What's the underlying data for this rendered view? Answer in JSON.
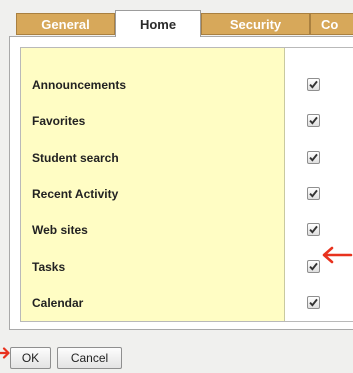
{
  "tabs": [
    {
      "label": "General",
      "active": false
    },
    {
      "label": "Home",
      "active": true
    },
    {
      "label": "Security",
      "active": false
    },
    {
      "label": "Co",
      "active": false
    }
  ],
  "settings": {
    "rows": [
      {
        "label": "Announcements",
        "checked": true
      },
      {
        "label": "Favorites",
        "checked": true
      },
      {
        "label": "Student search",
        "checked": true
      },
      {
        "label": "Recent Activity",
        "checked": true
      },
      {
        "label": "Web sites",
        "checked": true
      },
      {
        "label": "Tasks",
        "checked": true
      },
      {
        "label": "Calendar",
        "checked": true
      }
    ]
  },
  "buttons": {
    "ok": "OK",
    "cancel": "Cancel"
  },
  "colors": {
    "tab_inactive": "#d7a85a",
    "label_column": "#fffdc4",
    "annotation_arrow": "#e8321e"
  }
}
